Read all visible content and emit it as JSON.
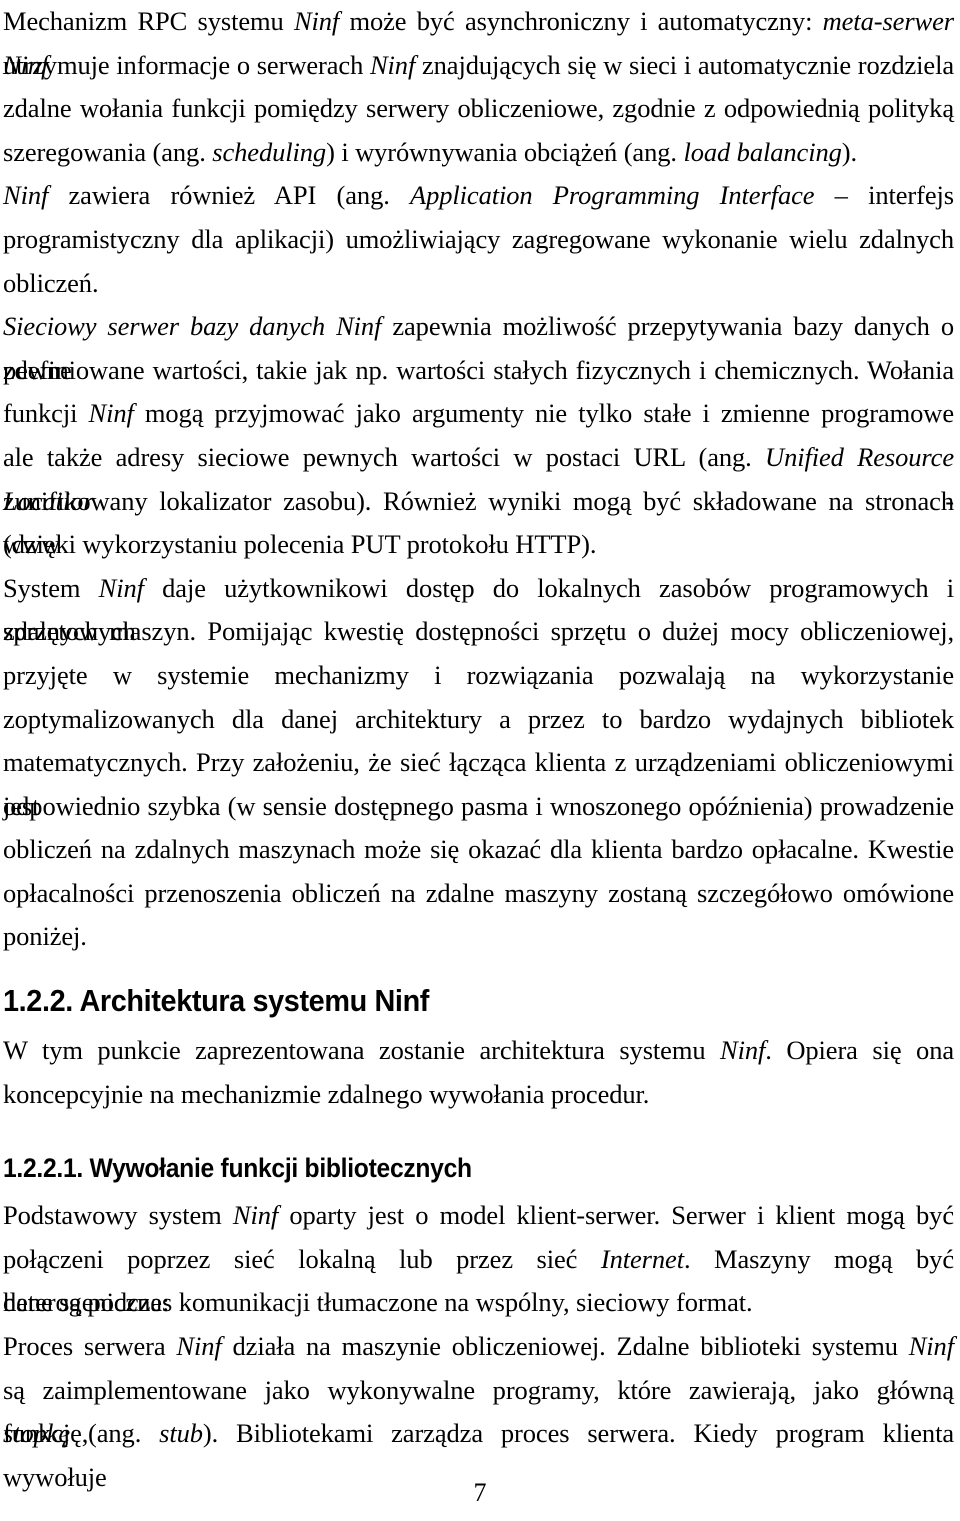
{
  "document": {
    "language": "pl",
    "page_number": "7",
    "text_color": "#000000",
    "background_color": "#ffffff"
  },
  "paragraphs": {
    "p1": {
      "name": "paragraph-rpc-mechanism",
      "lines": [
        "Mechanizm RPC systemu ",
        " może być asynchroniczny i automatyczny: ",
        "utrzymuje informacje o serwerach ",
        " znajdujących się w sieci i automatycznie rozdziela",
        "zdalne wołania funkcji pomiędzy serwery obliczeniowe, zgodnie z odpowiednią polityką",
        "szeregowania (ang. ",
        ") i wyrównywania obciążeń (ang. ",
        ")."
      ],
      "full_text": "Mechanizm RPC systemu Ninf może być asynchroniczny i automatyczny: meta-serwer Ninf utrzymuje informacje o serwerach Ninf znajdujących się w sieci i automatycznie rozdziela zdalne wołania funkcji pomiędzy serwery obliczeniowe, zgodnie z odpowiednią polityką szeregowania (ang. scheduling) i wyrównywania obciążeń (ang. load balancing).",
      "l1_a": "Mechanizm RPC systemu ",
      "l1_it1": "Ninf",
      "l1_b": " może być asynchroniczny i automatyczny: ",
      "l1_it2": "meta-serwer Ninf",
      "l2_a": "utrzymuje informacje o serwerach ",
      "l2_it1": "Ninf",
      "l2_b": " znajdujących się w sieci i automatycznie rozdziela",
      "l3": "zdalne wołania funkcji pomiędzy serwery obliczeniowe, zgodnie z odpowiednią polityką",
      "l4_a": "szeregowania (ang. ",
      "l4_it1": "scheduling",
      "l4_b": ") i wyrównywania obciążeń (ang. ",
      "l4_it2": "load balancing",
      "l4_c": ")."
    },
    "p2": {
      "name": "paragraph-api",
      "full_text": "Ninf zawiera również API (ang. Application Programming Interface – interfejs programistyczny dla aplikacji) umożliwiający zagregowane wykonanie wielu zdalnych obliczeń.",
      "l1_it1": "Ninf",
      "l1_a": " zawiera również API (ang. ",
      "l1_it2": "Application Programming Interface",
      "l1_b": " – interfejs",
      "l2": "programistyczny dla aplikacji) umożliwiający zagregowane wykonanie wielu zdalnych",
      "l3": "obliczeń."
    },
    "p3": {
      "name": "paragraph-network-database-server",
      "full_text": "Sieciowy serwer bazy danych Ninf zapewnia możliwość przepytywania bazy danych o pewne zdefiniowane wartości, takie jak np. wartości stałych fizycznych i chemicznych. Wołania funkcji Ninf mogą przyjmować jako argumenty nie tylko stałe i zmienne programowe ale także adresy sieciowe pewnych wartości w postaci URL (ang. Unified Resource Locatior - zunifikowany lokalizator zasobu). Również wyniki mogą być składowane na stronach www (dzięki wykorzystaniu polecenia PUT protokołu HTTP).",
      "l1_it1": "Sieciowy serwer bazy danych Ninf",
      "l1_a": " zapewnia możliwość przepytywania bazy danych o pewne",
      "l2": "zdefiniowane wartości, takie jak np. wartości stałych fizycznych i chemicznych. Wołania",
      "l3_a": "funkcji ",
      "l3_it1": "Ninf",
      "l3_b": " mogą przyjmować jako argumenty nie tylko stałe i zmienne programowe",
      "l4_a": "ale także adresy sieciowe pewnych wartości w postaci URL (ang. ",
      "l4_it1": "Unified Resource Locatior",
      "l4_b": " -",
      "l5": " zunifikowany lokalizator zasobu). Również wyniki mogą być składowane na stronach www",
      "l6": "(dzięki wykorzystaniu polecenia PUT protokołu HTTP)."
    },
    "p4": {
      "name": "paragraph-system-access",
      "full_text": "System Ninf daje użytkownikowi dostęp do lokalnych zasobów programowych i sprzętowych zdalnych maszyn. Pomijając kwestię dostępności sprzętu o dużej mocy obliczeniowej, przyjęte w systemie mechanizmy i rozwiązania pozwalają na wykorzystanie zoptymalizowanych dla danej architektury a przez to bardzo wydajnych bibliotek matematycznych. Przy założeniu, że sieć łącząca klienta z urządzeniami obliczeniowymi jest odpowiednio szybka (w sensie dostępnego pasma i wnoszonego opóźnienia) prowadzenie obliczeń na zdalnych maszynach może się okazać dla klienta bardzo opłacalne. Kwestie opłacalności przenoszenia obliczeń na zdalne maszyny zostaną szczegółowo omówione poniżej.",
      "l1_a": "System ",
      "l1_it1": "Ninf",
      "l1_b": " daje użytkownikowi dostęp do lokalnych zasobów programowych i sprzętowych",
      "l2": "zdalnych maszyn. Pomijając kwestię dostępności sprzętu o dużej mocy obliczeniowej,",
      "l3": "przyjęte w systemie mechanizmy i rozwiązania pozwalają na wykorzystanie",
      "l4": "zoptymalizowanych dla danej architektury a przez to bardzo wydajnych bibliotek",
      "l5": "matematycznych. Przy założeniu, że sieć łącząca klienta z urządzeniami obliczeniowymi jest",
      "l6": "odpowiednio szybka (w sensie dostępnego pasma i wnoszonego opóźnienia) prowadzenie",
      "l7": "obliczeń na zdalnych maszynach może się okazać dla klienta bardzo opłacalne. Kwestie",
      "l8": "opłacalności przenoszenia obliczeń na zdalne maszyny zostaną szczegółowo omówione",
      "l9": "poniżej."
    },
    "p5": {
      "name": "paragraph-architecture-intro",
      "full_text": "W tym punkcie zaprezentowana zostanie architektura systemu Ninf. Opiera się ona koncepcyjnie na mechanizmie zdalnego wywołania procedur.",
      "l1_a": "W tym punkcie zaprezentowana zostanie architektura systemu ",
      "l1_it1": "Ninf",
      "l1_b": ". Opiera się ona",
      "l2": "koncepcyjnie na mechanizmie zdalnego wywołania procedur."
    },
    "p6": {
      "name": "paragraph-client-server-model",
      "full_text": "Podstawowy system Ninf oparty jest o model klient-serwer. Serwer i klient mogą być połączeni poprzez sieć lokalną lub przez sieć Internet. Maszyny mogą być heterogeniczne: dane są podczas komunikacji tłumaczone na wspólny, sieciowy format.",
      "l1_a": "Podstawowy system ",
      "l1_it1": "Ninf",
      "l1_b": " oparty jest o model klient-serwer. Serwer i klient mogą być",
      "l2_a": "połączeni poprzez sieć lokalną lub przez sieć ",
      "l2_it1": "Internet",
      "l2_b": ". Maszyny mogą być heterogeniczne:",
      "l3": "dane są podczas komunikacji tłumaczone na wspólny, sieciowy format."
    },
    "p7": {
      "name": "paragraph-server-process",
      "full_text": "Proces serwera Ninf działa na maszynie obliczeniowej. Zdalne biblioteki systemu Ninf są zaimplementowane jako wykonywalne programy, które zawierają, jako główną funkcję, stopkę (ang. stub). Bibliotekami zarządza proces serwera. Kiedy program klienta wywołuje",
      "l1_a": "Proces serwera ",
      "l1_it1": "Ninf",
      "l1_b": " działa na maszynie obliczeniowej. Zdalne biblioteki systemu ",
      "l1_it2": "Ninf",
      "l2": "są zaimplementowane jako wykonywalne programy, które zawierają, jako główną funkcję,",
      "l3_it1": "stopkę",
      "l3_a": " (ang. ",
      "l3_it2": "stub",
      "l3_b": "). Bibliotekami zarządza proces serwera. Kiedy program klienta wywołuje"
    }
  },
  "headings": {
    "h_major": {
      "name": "heading-architektura-systemu-ninf",
      "number": "1.2.2.",
      "text": "1.2.2. Architektura systemu Ninf"
    },
    "h_minor": {
      "name": "heading-wywolanie-funkcji-bibliotecznych",
      "number": "1.2.2.1.",
      "text": "1.2.2.1. Wywołanie funkcji bibliotecznych"
    }
  },
  "footer": {
    "page_number": "7"
  }
}
